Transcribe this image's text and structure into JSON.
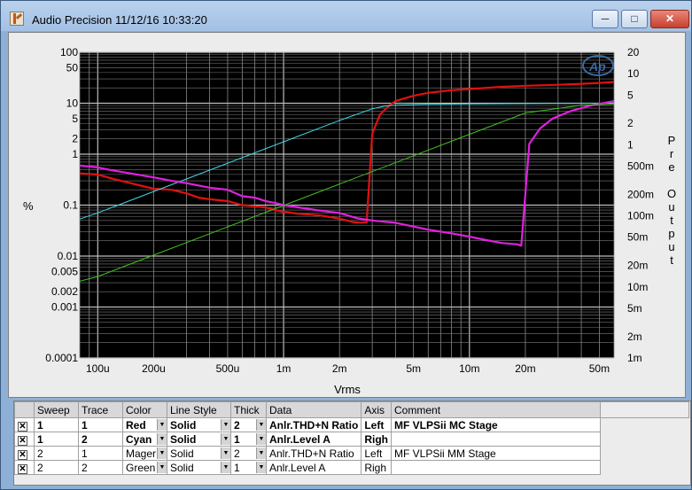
{
  "window": {
    "title": "Audio Precision  11/12/16 10:33:20",
    "min_glyph": "─",
    "max_glyph": "□",
    "close_glyph": "✕"
  },
  "chart_data": {
    "type": "line",
    "title": "",
    "xlabel": "Vrms",
    "ylabel": "%",
    "y2label": "Pre Output",
    "x_scale": "log",
    "y_scale": "log",
    "y2_scale": "log",
    "xlim": [
      8e-05,
      0.06
    ],
    "ylim": [
      0.0001,
      100
    ],
    "y2lim": [
      0.001,
      20
    ],
    "grid": true,
    "x_ticks": [
      {
        "v": 0.0001,
        "label": "100u"
      },
      {
        "v": 0.0002,
        "label": "200u"
      },
      {
        "v": 0.0005,
        "label": "500u"
      },
      {
        "v": 0.001,
        "label": "1m"
      },
      {
        "v": 0.002,
        "label": "2m"
      },
      {
        "v": 0.005,
        "label": "5m"
      },
      {
        "v": 0.01,
        "label": "10m"
      },
      {
        "v": 0.02,
        "label": "20m"
      },
      {
        "v": 0.05,
        "label": "50m"
      }
    ],
    "y_ticks": [
      {
        "v": 100,
        "label": "100"
      },
      {
        "v": 50,
        "label": "50"
      },
      {
        "v": 10,
        "label": "10"
      },
      {
        "v": 5,
        "label": "5"
      },
      {
        "v": 2,
        "label": "2"
      },
      {
        "v": 1,
        "label": "1"
      },
      {
        "v": 0.1,
        "label": "0.1"
      },
      {
        "v": 0.01,
        "label": "0.01"
      },
      {
        "v": 0.005,
        "label": "0.005"
      },
      {
        "v": 0.002,
        "label": "0.002"
      },
      {
        "v": 0.001,
        "label": "0.001"
      },
      {
        "v": 0.0001,
        "label": "0.0001"
      }
    ],
    "y2_ticks": [
      {
        "v": 20,
        "label": "20"
      },
      {
        "v": 10,
        "label": "10"
      },
      {
        "v": 5,
        "label": "5"
      },
      {
        "v": 2,
        "label": "2"
      },
      {
        "v": 1,
        "label": "1"
      },
      {
        "v": 0.5,
        "label": "500m"
      },
      {
        "v": 0.2,
        "label": "200m"
      },
      {
        "v": 0.1,
        "label": "100m"
      },
      {
        "v": 0.05,
        "label": "50m"
      },
      {
        "v": 0.02,
        "label": "20m"
      },
      {
        "v": 0.01,
        "label": "10m"
      },
      {
        "v": 0.005,
        "label": "5m"
      },
      {
        "v": 0.002,
        "label": "2m"
      },
      {
        "v": 0.001,
        "label": "1m"
      }
    ],
    "series": [
      {
        "color": "#e01010",
        "axis": "left",
        "points": [
          [
            8e-05,
            0.42
          ],
          [
            0.0001,
            0.4
          ],
          [
            0.00012,
            0.33
          ],
          [
            0.00015,
            0.27
          ],
          [
            0.0002,
            0.21
          ],
          [
            0.00025,
            0.2
          ],
          [
            0.0003,
            0.17
          ],
          [
            0.00035,
            0.14
          ],
          [
            0.0004,
            0.13
          ],
          [
            0.0005,
            0.12
          ],
          [
            0.0006,
            0.1
          ],
          [
            0.0007,
            0.095
          ],
          [
            0.0008,
            0.09
          ],
          [
            0.0009,
            0.08
          ],
          [
            0.001,
            0.074
          ],
          [
            0.0012,
            0.068
          ],
          [
            0.0014,
            0.065
          ],
          [
            0.0016,
            0.062
          ],
          [
            0.0018,
            0.058
          ],
          [
            0.002,
            0.054
          ],
          [
            0.0022,
            0.05
          ],
          [
            0.0024,
            0.046
          ],
          [
            0.0026,
            0.045
          ],
          [
            0.0028,
            0.046
          ],
          [
            0.003,
            2.5
          ],
          [
            0.0033,
            6
          ],
          [
            0.0037,
            9
          ],
          [
            0.004,
            11
          ],
          [
            0.005,
            14
          ],
          [
            0.006,
            16
          ],
          [
            0.008,
            18
          ],
          [
            0.01,
            19
          ],
          [
            0.015,
            21
          ],
          [
            0.02,
            22
          ],
          [
            0.03,
            23
          ],
          [
            0.04,
            24
          ],
          [
            0.05,
            25
          ],
          [
            0.06,
            26
          ]
        ]
      },
      {
        "color": "#40d8e8",
        "axis": "right",
        "points": [
          [
            8e-05,
            0.09
          ],
          [
            0.0001,
            0.11
          ],
          [
            0.0002,
            0.22
          ],
          [
            0.0005,
            0.55
          ],
          [
            0.001,
            1.1
          ],
          [
            0.002,
            2.2
          ],
          [
            0.003,
            3.2
          ],
          [
            0.0035,
            3.5
          ],
          [
            0.004,
            3.6
          ],
          [
            0.006,
            3.7
          ],
          [
            0.01,
            3.75
          ],
          [
            0.02,
            3.8
          ],
          [
            0.06,
            3.85
          ]
        ]
      },
      {
        "color": "#e020e0",
        "axis": "left",
        "points": [
          [
            8e-05,
            0.6
          ],
          [
            0.0001,
            0.55
          ],
          [
            0.00012,
            0.48
          ],
          [
            0.00015,
            0.42
          ],
          [
            0.0002,
            0.35
          ],
          [
            0.00025,
            0.3
          ],
          [
            0.0003,
            0.27
          ],
          [
            0.0004,
            0.22
          ],
          [
            0.0005,
            0.2
          ],
          [
            0.0006,
            0.15
          ],
          [
            0.0007,
            0.14
          ],
          [
            0.0008,
            0.12
          ],
          [
            0.0009,
            0.11
          ],
          [
            0.001,
            0.1
          ],
          [
            0.0012,
            0.09
          ],
          [
            0.0015,
            0.08
          ],
          [
            0.002,
            0.07
          ],
          [
            0.0025,
            0.055
          ],
          [
            0.003,
            0.05
          ],
          [
            0.004,
            0.045
          ],
          [
            0.005,
            0.038
          ],
          [
            0.006,
            0.033
          ],
          [
            0.008,
            0.028
          ],
          [
            0.01,
            0.024
          ],
          [
            0.012,
            0.021
          ],
          [
            0.015,
            0.018
          ],
          [
            0.018,
            0.017
          ],
          [
            0.019,
            0.016
          ],
          [
            0.021,
            1.6
          ],
          [
            0.024,
            3.2
          ],
          [
            0.028,
            5
          ],
          [
            0.035,
            7
          ],
          [
            0.045,
            9
          ],
          [
            0.06,
            11
          ]
        ]
      },
      {
        "color": "#40c020",
        "axis": "right",
        "points": [
          [
            8e-05,
            0.012
          ],
          [
            0.0001,
            0.014
          ],
          [
            0.0002,
            0.028
          ],
          [
            0.0005,
            0.07
          ],
          [
            0.001,
            0.14
          ],
          [
            0.002,
            0.28
          ],
          [
            0.005,
            0.7
          ],
          [
            0.01,
            1.4
          ],
          [
            0.02,
            2.8
          ],
          [
            0.04,
            3.6
          ],
          [
            0.06,
            3.7
          ]
        ]
      }
    ]
  },
  "legend": {
    "headers": [
      "Sweep",
      "Trace",
      "Color",
      "Line Style",
      "Thick",
      "Data",
      "Axis",
      "Comment"
    ],
    "rows": [
      {
        "checked": "✕",
        "sweep": "1",
        "trace": "1",
        "color": "Red",
        "style": "Solid",
        "thick": "2",
        "data": "Anlr.THD+N Ratio",
        "axis": "Left",
        "comment": "MF VLPSii MC Stage",
        "bold": true
      },
      {
        "checked": "✕",
        "sweep": "1",
        "trace": "2",
        "color": "Cyan",
        "style": "Solid",
        "thick": "1",
        "data": "Anlr.Level A",
        "axis": "Righ",
        "comment": "",
        "bold": true
      },
      {
        "checked": "✕",
        "sweep": "2",
        "trace": "1",
        "color": "Mager",
        "style": "Solid",
        "thick": "2",
        "data": "Anlr.THD+N Ratio",
        "axis": "Left",
        "comment": "MF VLPSii MM Stage",
        "bold": false
      },
      {
        "checked": "✕",
        "sweep": "2",
        "trace": "2",
        "color": "Green",
        "style": "Solid",
        "thick": "1",
        "data": "Anlr.Level A",
        "axis": "Righ",
        "comment": "",
        "bold": false
      }
    ]
  }
}
